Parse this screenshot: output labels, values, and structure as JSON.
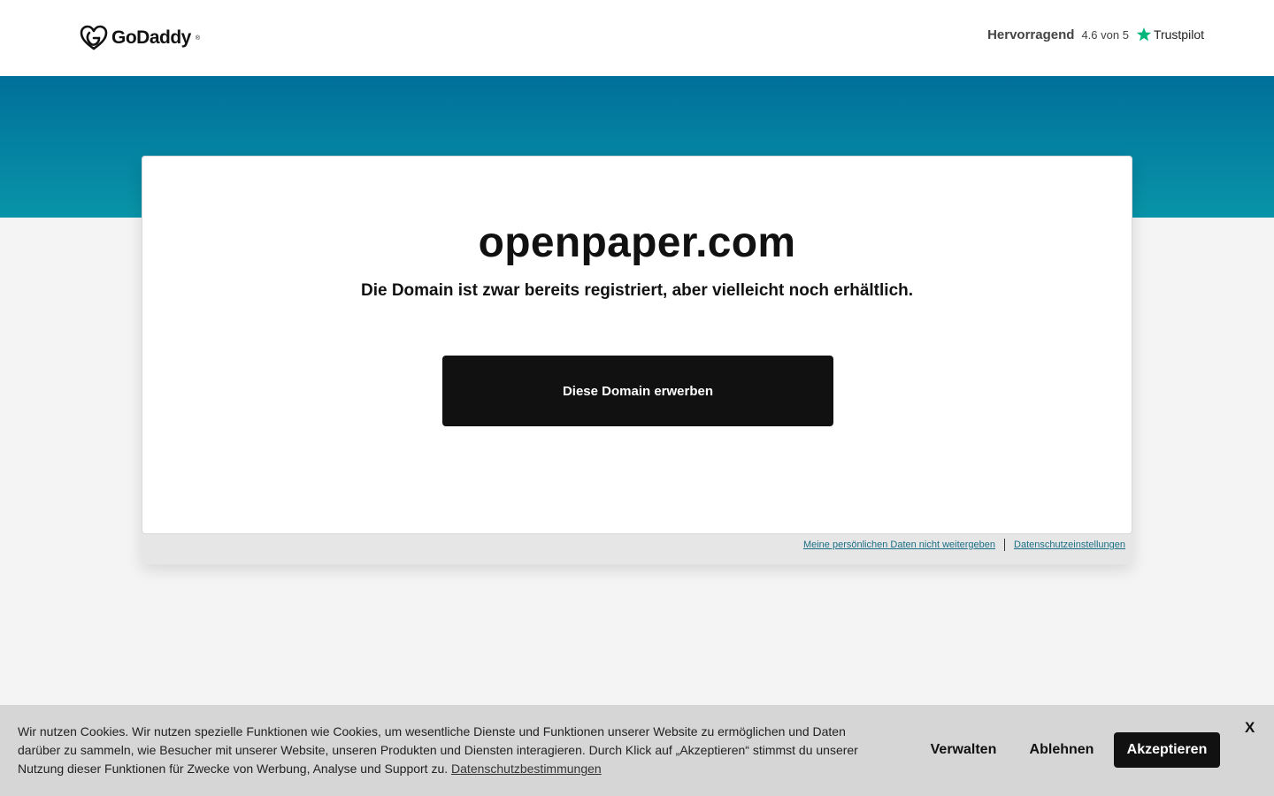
{
  "header": {
    "logo_text": "GoDaddy",
    "logo_tm": "®",
    "rating_word": "Hervorragend",
    "rating_score": "4.6 von 5",
    "trustpilot_label": "Trustpilot"
  },
  "main": {
    "domain": "openpaper.com",
    "subtitle": "Die Domain ist zwar bereits registriert, aber vielleicht noch erhältlich.",
    "buy_button": "Diese Domain erwerben"
  },
  "privacy": {
    "do_not_share": "Meine persönlichen Daten nicht weitergeben",
    "settings": "Datenschutzeinstellungen"
  },
  "cookie_banner": {
    "text": "Wir nutzen Cookies. Wir nutzen spezielle Funktionen wie Cookies, um wesentliche Dienste und Funktionen unserer Website zu ermöglichen und Daten darüber zu sammeln, wie Besucher mit unserer Website, unseren Produkten und Diensten interagieren. Durch Klick auf „Akzeptieren“ stimmst du unserer Nutzung dieser Funktionen für Zwecke von Werbung, Analyse und Support zu.",
    "link": "Datenschutzbestimmungen",
    "manage": "Verwalten",
    "decline": "Ablehnen",
    "accept": "Akzeptieren",
    "close": "X"
  },
  "colors": {
    "banner_top": "#00709a",
    "banner_bottom": "#0994a8",
    "trustpilot_star": "#00b67a",
    "link": "#1b6f86"
  }
}
